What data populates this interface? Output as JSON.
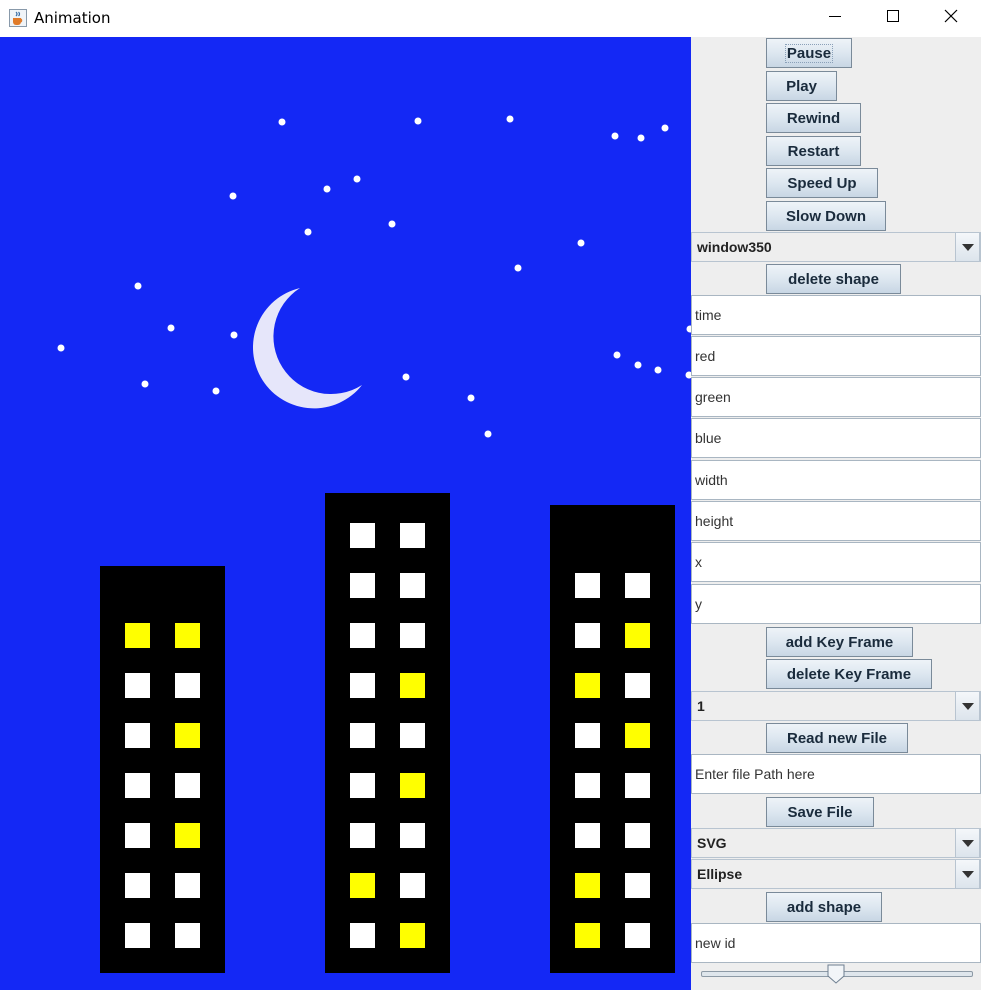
{
  "window": {
    "title": "Animation",
    "icon": "java-cup-icon",
    "controls": [
      "minimize-icon",
      "maximize-icon",
      "close-icon"
    ]
  },
  "colors": {
    "sky": "#1428f5",
    "moon": "#e6e6fa",
    "building": "#000000",
    "window_lit": "#ffff00",
    "window_off": "#ffffff",
    "star": "#ffffff"
  },
  "buttons": {
    "pause": "Pause",
    "play": "Play",
    "rewind": "Rewind",
    "restart": "Restart",
    "speed_up": "Speed Up",
    "slow_down": "Slow Down",
    "delete_shape": "delete shape",
    "add_key_frame": "add Key Frame",
    "delete_key_frame": "delete Key Frame",
    "read_new_file": "Read new File",
    "save_file": "Save File",
    "add_shape": "add shape"
  },
  "combos": {
    "shape_select": "window350",
    "keyframe_select": "1",
    "format_select": "SVG",
    "shape_type_select": "Ellipse"
  },
  "fields": {
    "time": "time",
    "red": "red",
    "green": "green",
    "blue": "blue",
    "width": "width",
    "height": "height",
    "x": "x",
    "y": "y",
    "file_path": "Enter file Path here",
    "new_id": "new id"
  },
  "speed_slider": {
    "value_fraction": 0.5
  },
  "buildings": [
    {
      "windows": [
        [
          "y",
          "y"
        ],
        [
          "w",
          "w"
        ],
        [
          "w",
          "y"
        ],
        [
          "w",
          "w"
        ],
        [
          "w",
          "y"
        ],
        [
          "w",
          "w"
        ],
        [
          "w",
          "w"
        ]
      ]
    },
    {
      "windows": [
        [
          "w",
          "w"
        ],
        [
          "w",
          "w"
        ],
        [
          "w",
          "w"
        ],
        [
          "w",
          "y"
        ],
        [
          "w",
          "w"
        ],
        [
          "w",
          "y"
        ],
        [
          "w",
          "w"
        ],
        [
          "y",
          "w"
        ],
        [
          "w",
          "y"
        ]
      ]
    },
    {
      "windows": [
        [
          "w",
          "w"
        ],
        [
          "w",
          "y"
        ],
        [
          "y",
          "w"
        ],
        [
          "w",
          "y"
        ],
        [
          "w",
          "w"
        ],
        [
          "w",
          "w"
        ],
        [
          "y",
          "w"
        ],
        [
          "y",
          "w"
        ]
      ]
    }
  ]
}
